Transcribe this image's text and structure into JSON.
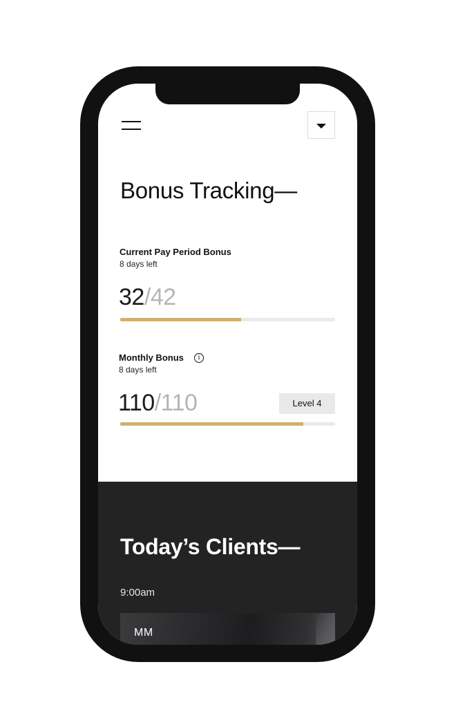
{
  "header": {
    "menu_icon": "hamburger-menu-icon",
    "dropdown_icon": "caret-down-icon"
  },
  "bonus_tracking": {
    "title": "Bonus Tracking—",
    "current_pay_period": {
      "label": "Current Pay Period Bonus",
      "days_left": "8 days left",
      "count": "32",
      "total": "/42",
      "progress": 0.5627
    },
    "monthly": {
      "label": "Monthly Bonus",
      "info_icon": "info-circle-icon",
      "info_glyph": "i",
      "days_left": "8 days left",
      "count": "110",
      "total": "/110",
      "level": "Level 4",
      "progress": 0.8521
    },
    "accent_color": "#d1b06f"
  },
  "todays_clients": {
    "title": "Today’s Clients—",
    "time": "9:00am",
    "clients": [
      {
        "initials": "MM"
      }
    ]
  }
}
